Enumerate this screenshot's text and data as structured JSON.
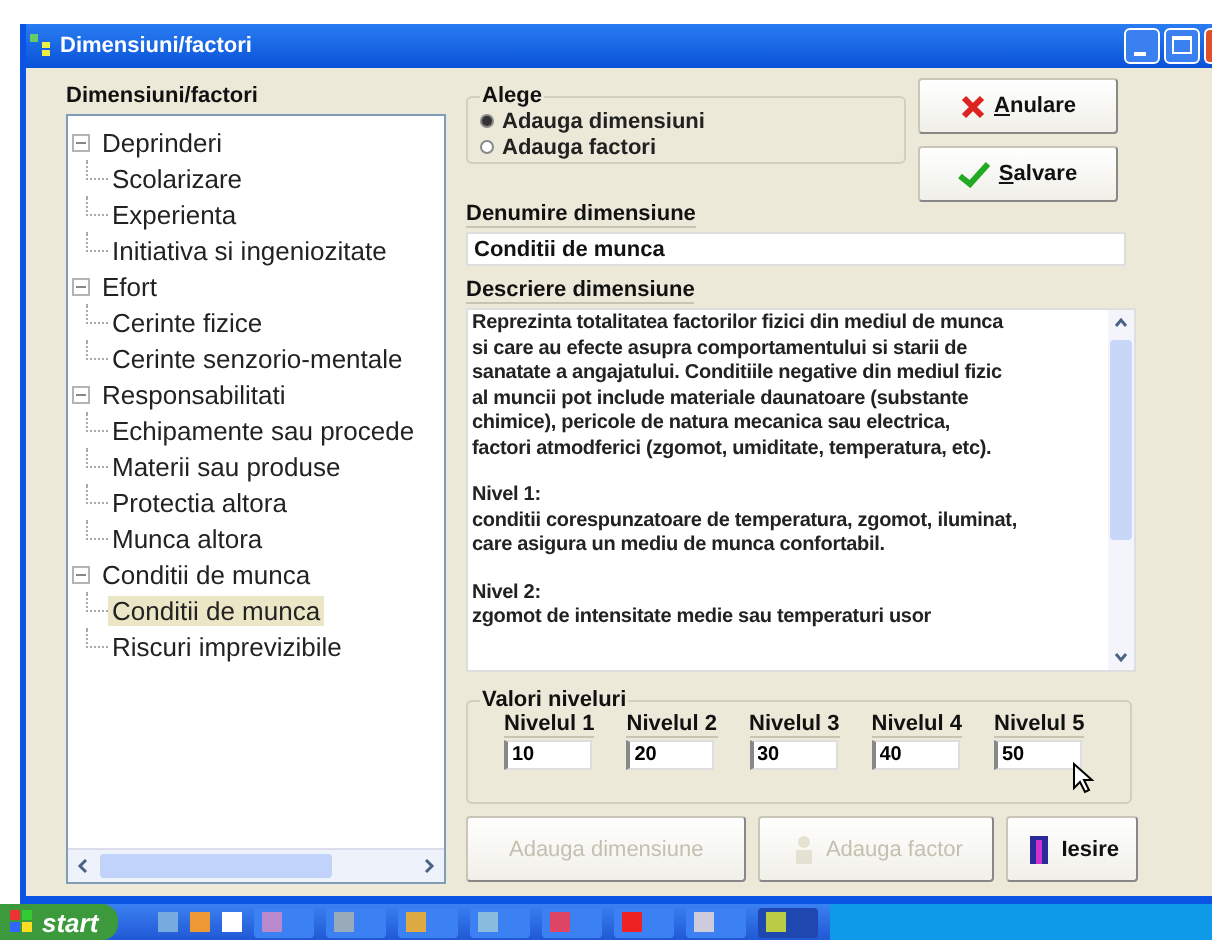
{
  "window": {
    "title": "Dimensiuni/factori"
  },
  "tree": {
    "label": "Dimensiuni/factori",
    "items": [
      {
        "label": "Deprinderi",
        "expanded": true,
        "selected": false,
        "children": [
          {
            "label": "Scolarizare",
            "selected": false
          },
          {
            "label": "Experienta",
            "selected": false
          },
          {
            "label": "Initiativa si ingeniozitate",
            "selected": false
          }
        ]
      },
      {
        "label": "Efort",
        "expanded": true,
        "selected": false,
        "children": [
          {
            "label": "Cerinte fizice",
            "selected": false
          },
          {
            "label": "Cerinte senzorio-mentale",
            "selected": false
          }
        ]
      },
      {
        "label": "Responsabilitati",
        "expanded": true,
        "selected": false,
        "children": [
          {
            "label": "Echipamente sau procede",
            "selected": false
          },
          {
            "label": "Materii sau produse",
            "selected": false
          },
          {
            "label": "Protectia altora",
            "selected": false
          },
          {
            "label": "Munca altora",
            "selected": false
          }
        ]
      },
      {
        "label": "Conditii de munca",
        "expanded": true,
        "selected": false,
        "children": [
          {
            "label": "Conditii de munca",
            "selected": true
          },
          {
            "label": "Riscuri imprevizibile",
            "selected": false
          }
        ]
      }
    ]
  },
  "choice": {
    "label": "Alege",
    "options": [
      {
        "label": "Adauga dimensiuni",
        "selected": true
      },
      {
        "label": "Adauga factori",
        "selected": false
      }
    ]
  },
  "buttons_top": [
    {
      "kind": "cancel",
      "label": "Anulare"
    },
    {
      "kind": "save",
      "label": "Salvare"
    }
  ],
  "name_field": {
    "label": "Denumire dimensiune",
    "value": "Conditii de munca"
  },
  "description": {
    "label": "Descriere dimensiune",
    "paragraphs": [
      [
        "Reprezinta totalitatea factorilor fizici din mediul de munca",
        "si care au efecte asupra comportamentului si starii de",
        "sanatate a angajatului. Conditiile negative din mediul fizic",
        "al muncii pot include materiale daunatoare (substante",
        "chimice), pericole de natura mecanica sau electrica,",
        "factori atmodferici (zgomot, umiditate, temperatura, etc)."
      ],
      [
        "Nivel 1:",
        "conditii corespunzatoare de temperatura, zgomot, iluminat,",
        "care asigura un mediu de munca confortabil."
      ],
      [
        "Nivel 2:",
        "zgomot de intensitate medie sau temperaturi usor"
      ]
    ]
  },
  "levels": {
    "label": "Valori niveluri",
    "items": [
      {
        "label": "Nivelul 1",
        "value": "10"
      },
      {
        "label": "Nivelul 2",
        "value": "20"
      },
      {
        "label": "Nivelul 3",
        "value": "30"
      },
      {
        "label": "Nivelul 4",
        "value": "40"
      },
      {
        "label": "Nivelul 5",
        "value": "50"
      }
    ]
  },
  "buttons_bottom": [
    {
      "kind": "add-dimension",
      "label": "Adauga dimensiune",
      "disabled": true
    },
    {
      "kind": "add-factor",
      "label": "Adauga factor",
      "disabled": true
    },
    {
      "kind": "exit",
      "label": "Iesire",
      "disabled": false
    }
  ],
  "taskbar": {
    "start": "start"
  }
}
